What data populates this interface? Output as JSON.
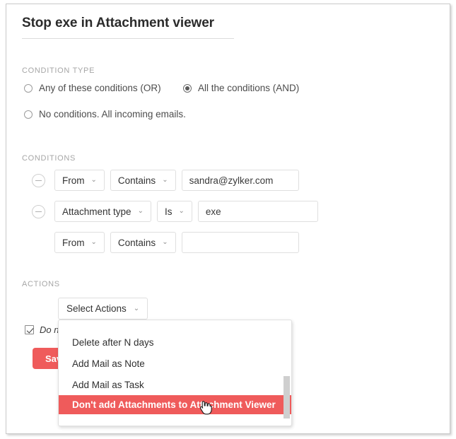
{
  "rule": {
    "title": "Stop exe in Attachment viewer"
  },
  "condition_type": {
    "caption": "CONDITION TYPE",
    "options": [
      {
        "label": "Any of these conditions (OR)",
        "selected": false
      },
      {
        "label": "All the conditions (AND)",
        "selected": true
      },
      {
        "label": "No conditions. All incoming emails.",
        "selected": false
      }
    ]
  },
  "conditions": {
    "caption": "CONDITIONS",
    "rows": [
      {
        "has_remove": true,
        "field": "From",
        "operator": "Contains",
        "value": "sandra@zylker.com",
        "value_placeholder": ""
      },
      {
        "has_remove": true,
        "field": "Attachment type",
        "operator": "Is",
        "value": "exe",
        "value_placeholder": ""
      },
      {
        "has_remove": false,
        "field": "From",
        "operator": "Contains",
        "value": "",
        "value_placeholder": ""
      }
    ],
    "chevron": "⌄"
  },
  "actions": {
    "caption": "ACTIONS",
    "select_label": "Select Actions",
    "chevron": "⌄",
    "dropdown_items": [
      {
        "label": "Delete after N days",
        "highlighted": false
      },
      {
        "label": "Add Mail as Note",
        "highlighted": false
      },
      {
        "label": "Add Mail as Task",
        "highlighted": false
      },
      {
        "label": "Don't add Attachments to Attachment Viewer",
        "highlighted": true
      }
    ]
  },
  "footer": {
    "checkbox_label": "Do n",
    "checkbox_checked": true,
    "save_label": "Save"
  },
  "colors": {
    "accent": "#ef5b5b",
    "caption": "#a6a6a6",
    "text": "#333333",
    "border": "#dfdfdf"
  }
}
